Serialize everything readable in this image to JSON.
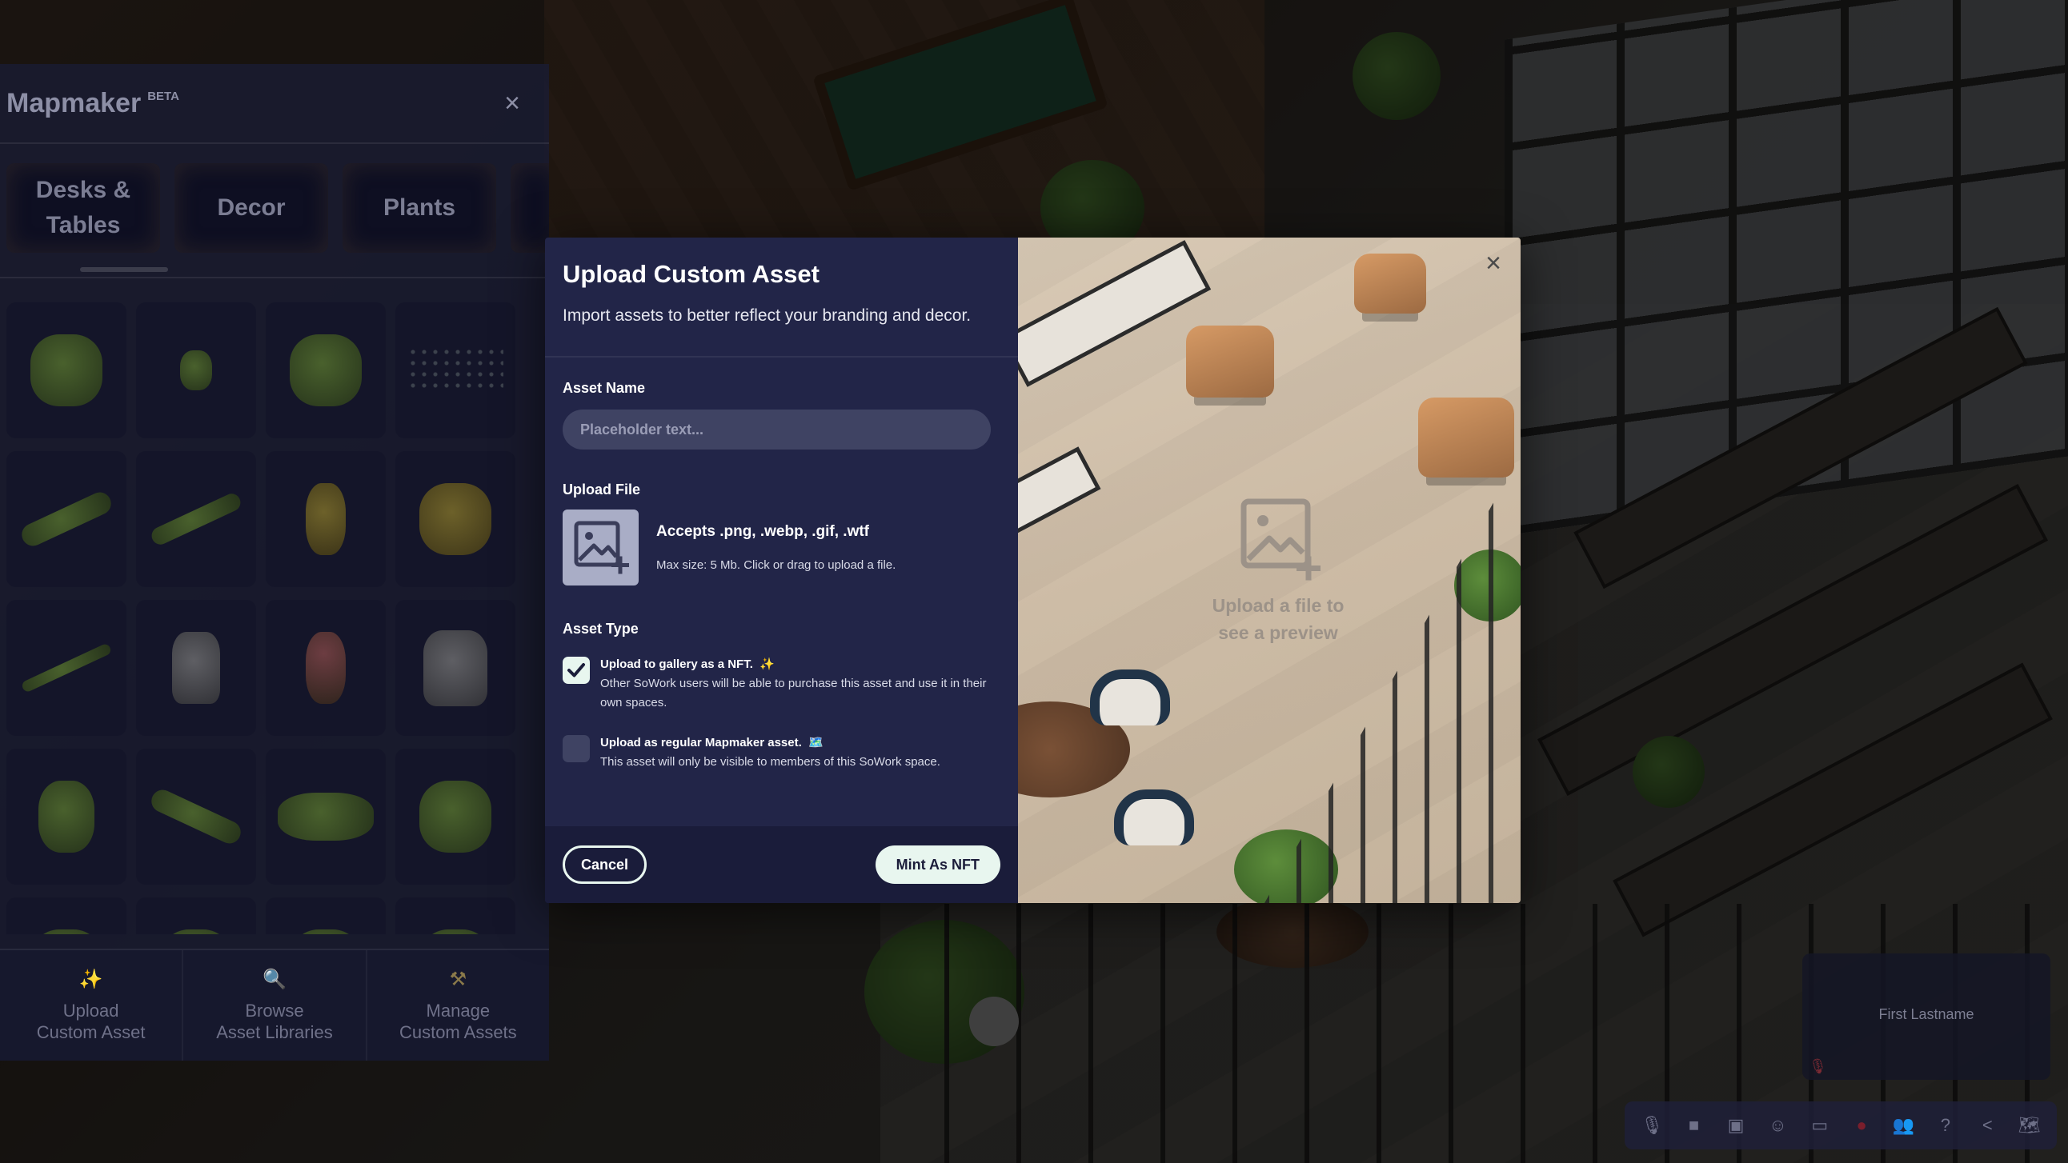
{
  "mapmaker": {
    "title": "Mapmaker",
    "badge": "BETA",
    "categories": [
      {
        "label": "Desks &\nTables"
      },
      {
        "label": "Decor"
      },
      {
        "label": "Plants"
      },
      {
        "label": ""
      }
    ],
    "footer": {
      "upload_label": "Upload\nCustom Asset",
      "browse_label": "Browse\nAsset Libraries",
      "manage_label": "Manage\nCustom Assets"
    }
  },
  "modal": {
    "title": "Upload Custom Asset",
    "subtitle": "Import assets to better reflect your branding and decor.",
    "asset_name_label": "Asset Name",
    "asset_name_placeholder": "Placeholder text...",
    "asset_name_value": "",
    "upload_file_label": "Upload File",
    "upload_accepts": "Accepts .png, .webp, .gif, .wtf",
    "upload_max": "Max size: 5 Mb. Click or drag to upload a file.",
    "asset_type_label": "Asset Type",
    "options": [
      {
        "title": "Upload to gallery as a NFT.",
        "emoji": "✨",
        "desc": "Other SoWork users will be able to purchase this asset and use it in their own spaces.",
        "checked": true
      },
      {
        "title": "Upload as regular Mapmaker asset.",
        "emoji": "🗺️",
        "desc": "This asset will only be visible to members of this SoWork space.",
        "checked": false
      }
    ],
    "cancel_label": "Cancel",
    "submit_label": "Mint As NFT",
    "preview_hint": "Upload a file to see a preview"
  },
  "video_tile": {
    "name": "First Lastname"
  },
  "toolbar": {
    "icons": [
      "microphone-icon",
      "camera-icon",
      "screen-share-icon",
      "emoji-icon",
      "cast-icon",
      "record-icon",
      "people-icon",
      "help-icon",
      "share-icon",
      "map-icon"
    ]
  },
  "colors": {
    "modal_bg": "#222548",
    "modal_footer_bg": "#1a1c3a",
    "accent_mint": "#e8f6ef",
    "input_bg": "#3f4363"
  }
}
